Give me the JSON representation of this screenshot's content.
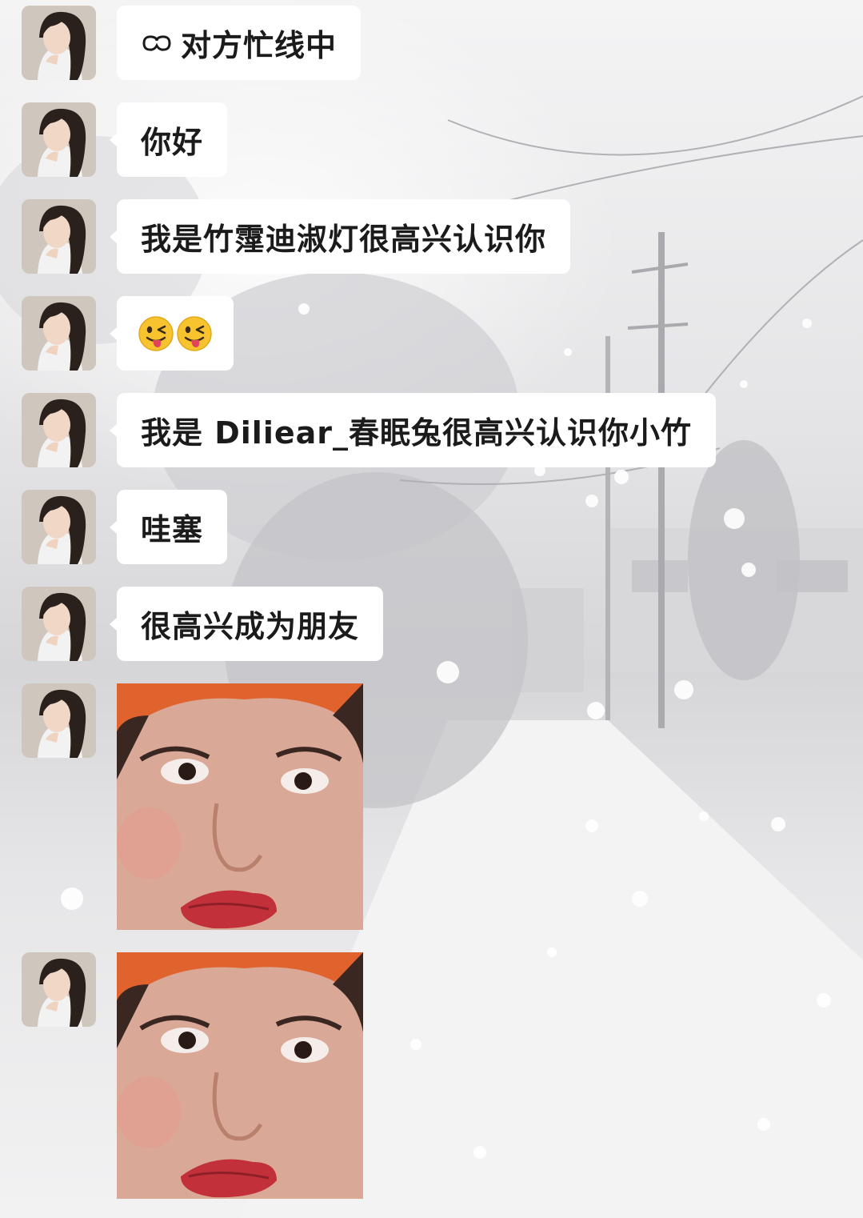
{
  "status": {
    "icon": "sleep-mask-icon",
    "text": "对方忙线中"
  },
  "messages": [
    {
      "type": "text",
      "text": "你好"
    },
    {
      "type": "text",
      "text": "我是竹霪迪淑灯很高兴认识你"
    },
    {
      "type": "emoji",
      "emojis": [
        "winking-face-with-tongue-emoji",
        "winking-face-with-tongue-emoji"
      ]
    },
    {
      "type": "text",
      "text": "我是 Diliear_春眠兔很高兴认识你小竹"
    },
    {
      "type": "text",
      "text": "哇塞"
    },
    {
      "type": "text",
      "text": "很高兴成为朋友"
    },
    {
      "type": "image",
      "subject": "close-up selfie with pursed red lips and orange beanie"
    },
    {
      "type": "image",
      "subject": "close-up selfie with pursed red lips and orange beanie"
    }
  ],
  "colors": {
    "bubble": "#ffffff",
    "text": "#1b1b1b",
    "background": "#e9e9ea",
    "beanie": "#e0632e",
    "lips": "#c2303a"
  }
}
